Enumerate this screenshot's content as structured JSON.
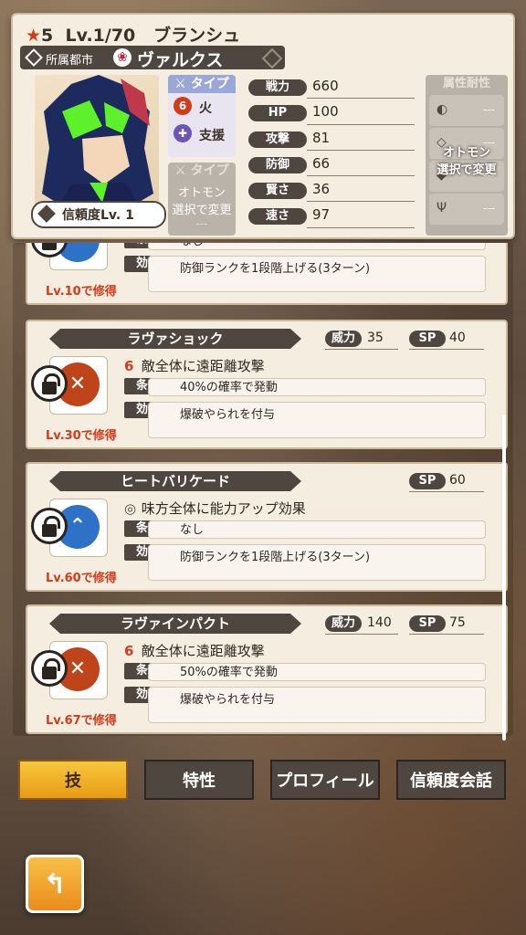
{
  "header": {
    "rarity": "5",
    "level": "Lv.1/70",
    "name": "ブランシュ",
    "city_label": "所属都市",
    "city_name": "ヴァルクス",
    "trust": "信頼度Lv.  1",
    "type_header": "タイプ",
    "types": [
      {
        "label": "火",
        "color": "#d43b1a",
        "icon": "fire-icon"
      },
      {
        "label": "支援",
        "color": "#6a55b8",
        "icon": "support-icon"
      }
    ],
    "otomon": {
      "header": "タイプ",
      "line1": "オトモン",
      "line2": "選択で変更",
      "line3": "---"
    },
    "stats": [
      {
        "key": "戦力",
        "value": "660"
      },
      {
        "key": "HP",
        "value": "100"
      },
      {
        "key": "攻撃",
        "value": "81"
      },
      {
        "key": "防御",
        "value": "66"
      },
      {
        "key": "賢さ",
        "value": "36"
      },
      {
        "key": "速さ",
        "value": "97"
      }
    ],
    "resist": {
      "header": "属性耐性",
      "rows": [
        "---",
        "---",
        "---",
        "---"
      ],
      "overlay1": "オトモン",
      "overlay2": "選択で変更"
    }
  },
  "skills": [
    {
      "name": "",
      "desc": "",
      "cond": "なし",
      "effect": "防御ランクを1段階上げる(3ターン)",
      "level": "Lv.10で修得",
      "power": "",
      "sp": "",
      "icon_color": "#2d72c7",
      "element": "none"
    },
    {
      "name": "ラヴァショック",
      "desc": "敵全体に遠距離攻撃",
      "cond": "40%の確率で発動",
      "effect": "爆破やられを付与",
      "level": "Lv.30で修得",
      "power": "35",
      "sp": "40",
      "icon_color": "#c0441a",
      "element": "fire"
    },
    {
      "name": "ヒートバリケード",
      "desc": "味方全体に能力アップ効果",
      "cond": "なし",
      "effect": "防御ランクを1段階上げる(3ターン)",
      "level": "Lv.60で修得",
      "power": "",
      "sp": "60",
      "icon_color": "#2d72c7",
      "element": "none"
    },
    {
      "name": "ラヴァインパクト",
      "desc": "敵全体に遠距離攻撃",
      "cond": "50%の確率で発動",
      "effect": "爆破やられを付与",
      "level": "Lv.67で修得",
      "power": "140",
      "sp": "75",
      "icon_color": "#c0441a",
      "element": "fire"
    }
  ],
  "labels": {
    "power": "威力",
    "sp": "SP",
    "cond": "条件",
    "effect": "効果"
  },
  "tabs": [
    "技",
    "特性",
    "プロフィール",
    "信頼度会話"
  ]
}
